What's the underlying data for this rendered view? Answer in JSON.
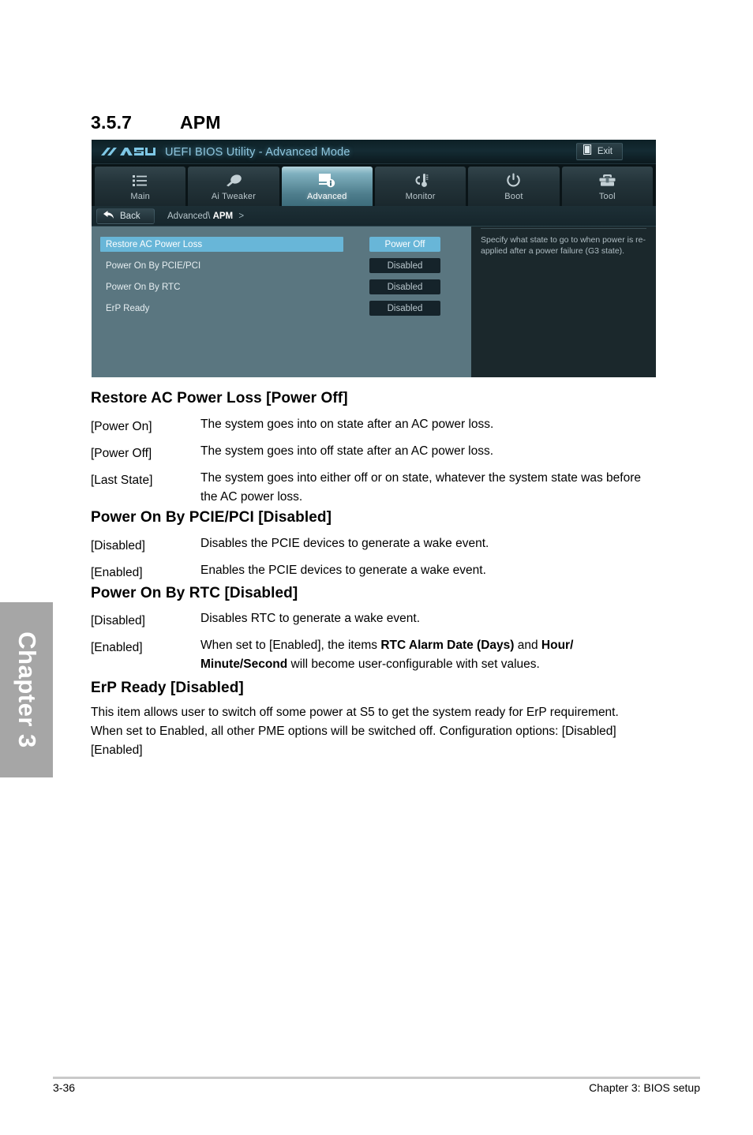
{
  "section": {
    "number": "3.5.7",
    "title": "APM"
  },
  "chapter_tab": {
    "label": "Chapter 3"
  },
  "bios": {
    "logo": "asus-logo",
    "title": "UEFI BIOS Utility - Advanced Mode",
    "exit_label": "Exit",
    "tabs": [
      {
        "label": "Main",
        "icon": "list-icon",
        "active": false
      },
      {
        "label": "Ai  Tweaker",
        "icon": "dial-icon",
        "active": false
      },
      {
        "label": "Advanced",
        "icon": "monitor-info-icon",
        "active": true
      },
      {
        "label": "Monitor",
        "icon": "thermometer-icon",
        "active": false
      },
      {
        "label": "Boot",
        "icon": "power-icon",
        "active": false
      },
      {
        "label": "Tool",
        "icon": "toolbox-icon",
        "active": false
      }
    ],
    "back_label": "Back",
    "breadcrumb": {
      "parent": "Advanced\\",
      "current": "APM",
      "arrow": ">"
    },
    "settings": [
      {
        "name": "Restore AC Power Loss",
        "value": "Power Off",
        "selected": true
      },
      {
        "name": "Power On By PCIE/PCI",
        "value": "Disabled",
        "selected": false
      },
      {
        "name": "Power On By RTC",
        "value": "Disabled",
        "selected": false
      },
      {
        "name": "ErP Ready",
        "value": "Disabled",
        "selected": false
      }
    ],
    "help_text": "Specify what state to go to when power is re-applied after a power failure (G3 state)."
  },
  "sections": {
    "restore": {
      "heading": "Restore AC Power Loss [Power Off]",
      "items": [
        {
          "term": "[Power On]",
          "desc": "The system goes into on state after an AC power loss."
        },
        {
          "term": "[Power Off]",
          "desc": "The system goes into off state after an AC power loss."
        },
        {
          "term": "[Last State]",
          "desc": "The system goes into either off or on state, whatever the system state was before the AC power loss."
        }
      ]
    },
    "pcie": {
      "heading": "Power On By PCIE/PCI [Disabled]",
      "items": [
        {
          "term": "[Disabled]",
          "desc": "Disables the PCIE devices to generate a wake event."
        },
        {
          "term": "[Enabled]",
          "desc": "Enables the PCIE devices to generate a wake event."
        }
      ]
    },
    "rtc": {
      "heading": "Power On By RTC [Disabled]",
      "items": [
        {
          "term": "[Disabled]",
          "desc": "Disables RTC to generate a wake event."
        }
      ],
      "enabled_term": "[Enabled]",
      "enabled_desc_1": "When set to [Enabled], the items ",
      "enabled_bold_1": "RTC Alarm Date (Days)",
      "enabled_desc_2": " and ",
      "enabled_bold_2": "Hour/ Minute/Second",
      "enabled_desc_3": " will become user-configurable with set values."
    },
    "erp": {
      "heading": "ErP Ready [Disabled]",
      "body": "This item allows user to switch off some power at S5 to get the system ready for ErP requirement. When set to Enabled, all other PME options will be switched off. Configuration options: [Disabled] [Enabled]"
    }
  },
  "footer": {
    "page": "3-36",
    "chapter": "Chapter 3: BIOS setup"
  }
}
